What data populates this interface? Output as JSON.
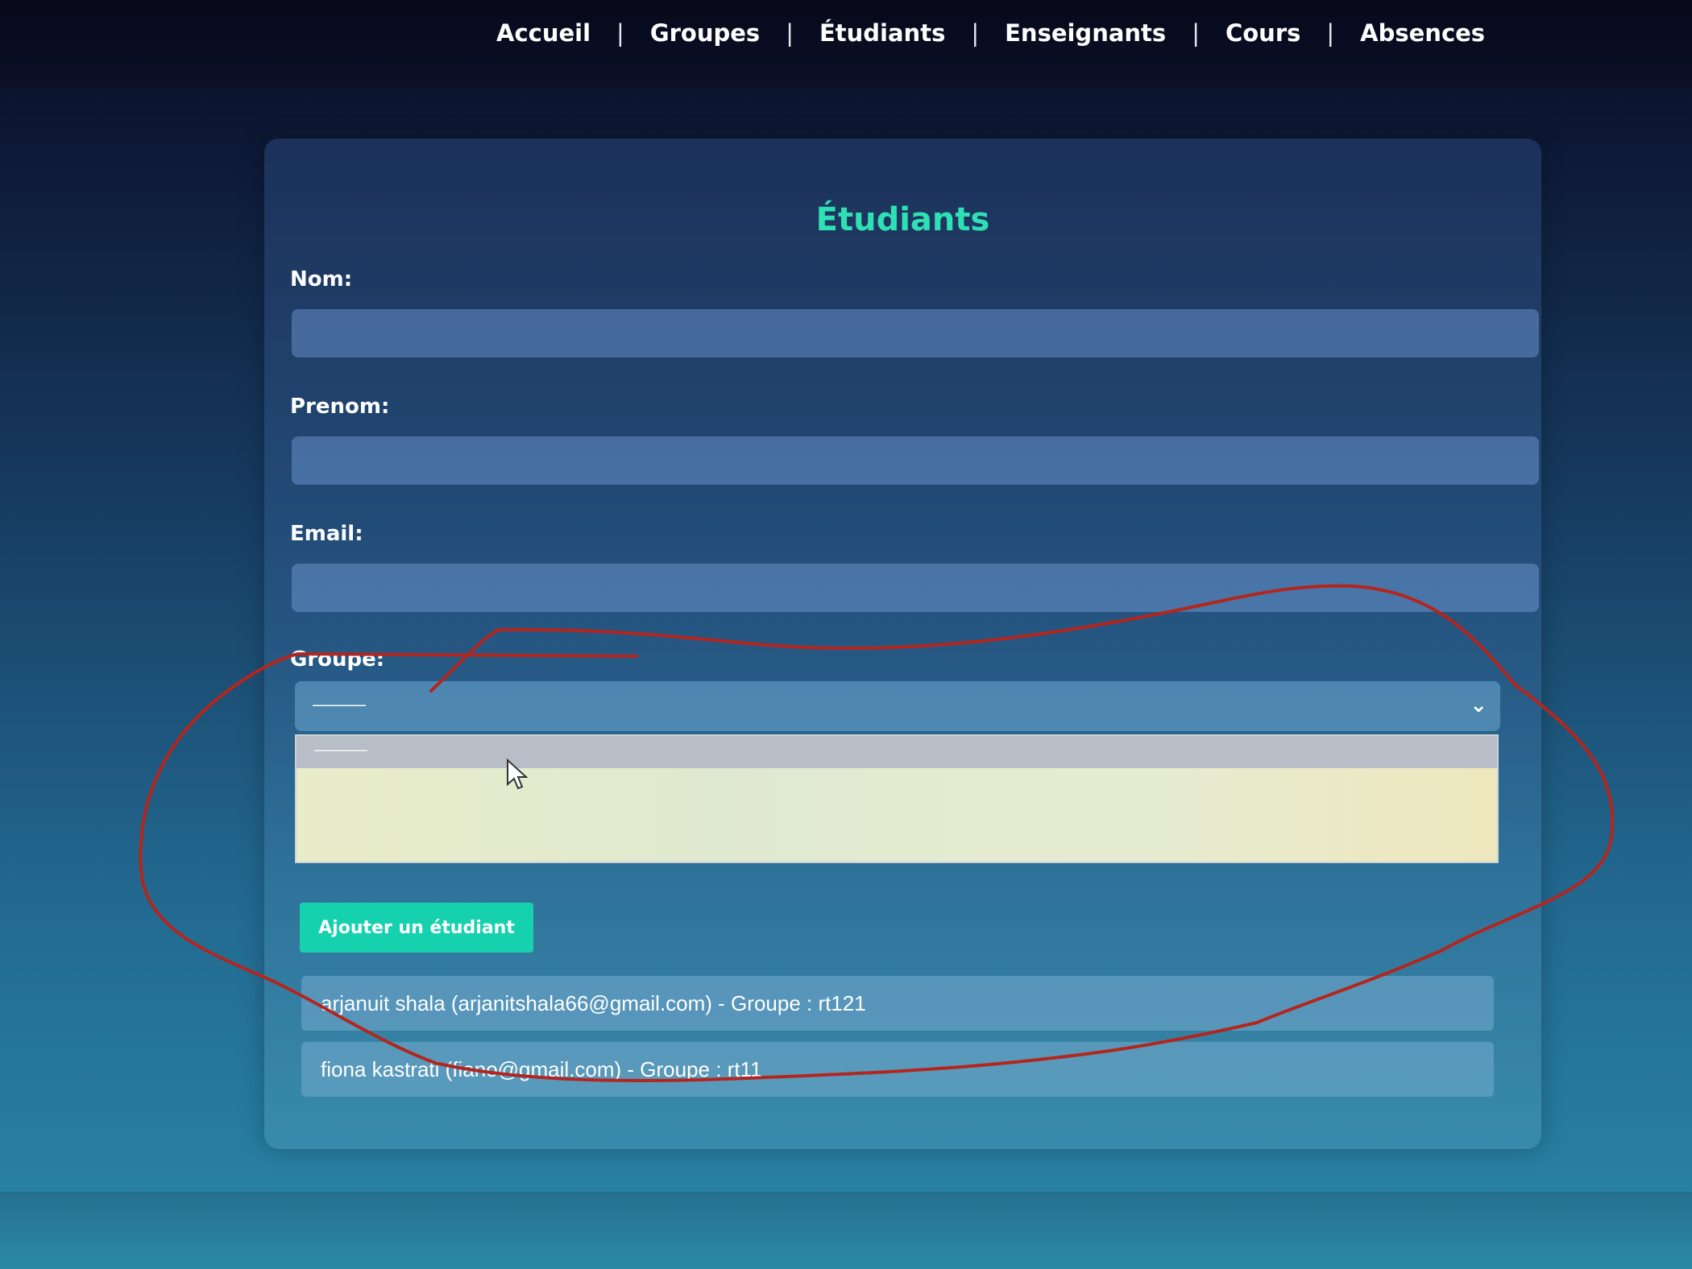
{
  "nav": {
    "items": [
      {
        "label": "Accueil"
      },
      {
        "label": "Groupes"
      },
      {
        "label": "Étudiants"
      },
      {
        "label": "Enseignants"
      },
      {
        "label": "Cours"
      },
      {
        "label": "Absences"
      }
    ],
    "separator": "|"
  },
  "form": {
    "title": "Étudiants",
    "nom_label": "Nom:",
    "nom_value": "",
    "prenom_label": "Prenom:",
    "prenom_value": "",
    "email_label": "Email:",
    "email_value": "",
    "groupe_label": "Groupe:",
    "groupe_selected": "———",
    "groupe_options": [
      "———"
    ],
    "submit_label": "Ajouter un étudiant"
  },
  "students": [
    {
      "text": "arjanuit shala (arjanitshala66@gmail.com) - Groupe : rt121"
    },
    {
      "text": "fiona kastrati (fiano@gmail.com) - Groupe : rt11"
    }
  ],
  "colors": {
    "accent": "#16d1ae",
    "title": "#2fe0b4",
    "annotation": "#b3261e"
  },
  "icons": {
    "select_arrow": "chevron-down-icon",
    "pointer": "cursor-icon"
  }
}
